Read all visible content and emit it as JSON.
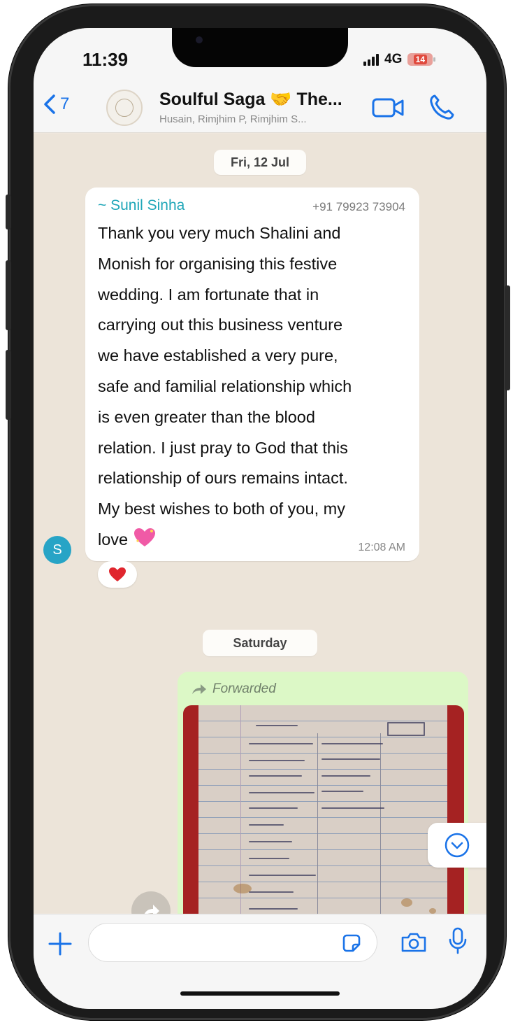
{
  "status_bar": {
    "time": "11:39",
    "network": "4G",
    "battery_level": "14",
    "battery_color": "#e0493d"
  },
  "header": {
    "back_count": "7",
    "title": "Soulful Saga",
    "title_suffix": "The...",
    "subtitle": "Husain, Rimjhim P, Rimjhim S...",
    "icons": [
      "video-call-icon",
      "voice-call-icon"
    ],
    "accent": "#1a73e8"
  },
  "chat": {
    "date_separator_1": "Fri, 12 Jul",
    "message_1": {
      "sender": "~ Sunil Sinha",
      "sender_phone": "+91 79923 73904",
      "avatar_letter": "S",
      "lines": [
        "Thank you very much Shalini and",
        "Monish for organising this festive",
        "wedding. I am fortunate that in",
        "carrying out this business venture",
        "we have established a very pure,",
        "safe and familial relationship which",
        "is even greater than the blood",
        "relation. I just pray to God that this",
        "relationship of ours remains intact.",
        "My best wishes to both of you, my",
        "love"
      ],
      "time": "12:08 AM",
      "reaction": "heart"
    },
    "date_separator_2": "Saturday",
    "message_2": {
      "forwarded_label": "Forwarded",
      "attachment": "photo"
    },
    "bubble_out_color": "#dcf8c6",
    "sender_color": "#1fa6b8"
  },
  "input_bar": {
    "placeholder": "",
    "icons": [
      "plus-icon",
      "sticker-icon",
      "camera-icon",
      "mic-icon"
    ]
  }
}
